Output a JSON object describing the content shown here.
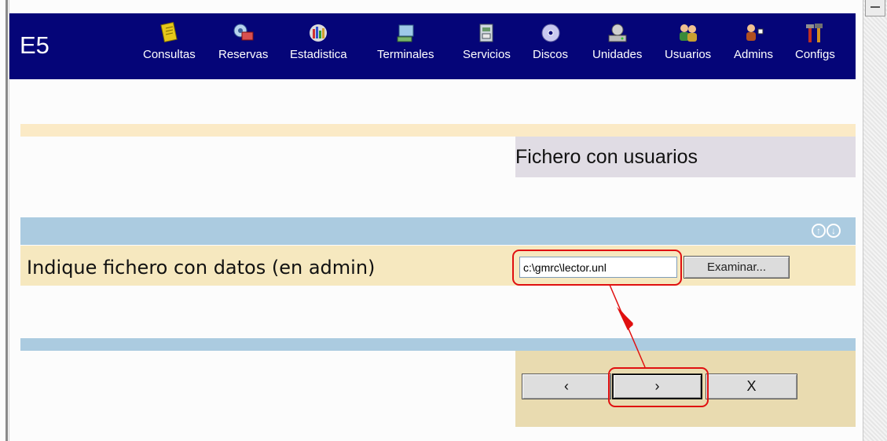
{
  "app": {
    "brand": "E5"
  },
  "nav": [
    {
      "label": "Consultas",
      "icon": "notepad-icon"
    },
    {
      "label": "Reservas",
      "icon": "reservation-icon"
    },
    {
      "label": "Estadistica",
      "icon": "statistics-icon"
    },
    {
      "label": "Terminales",
      "icon": "terminal-icon"
    },
    {
      "label": "Servicios",
      "icon": "services-icon"
    },
    {
      "label": "Discos",
      "icon": "disc-icon"
    },
    {
      "label": "Unidades",
      "icon": "drive-icon"
    },
    {
      "label": "Usuarios",
      "icon": "users-icon"
    },
    {
      "label": "Admins",
      "icon": "admin-icon"
    },
    {
      "label": "Configs",
      "icon": "tools-icon"
    }
  ],
  "page": {
    "title": "Fichero con usuarios"
  },
  "form": {
    "label": "Indique fichero con datos (en admin)",
    "file_value": "c:\\gmrc\\lector.unl",
    "browse_label": "Examinar...",
    "move_up_icon": "arrow-up-circle-icon",
    "move_down_icon": "arrow-down-circle-icon"
  },
  "wizard": {
    "back_label": "‹",
    "next_label": "›",
    "cancel_label": "X"
  },
  "colors": {
    "topbar": "#050578",
    "cream": "#f6e8bf",
    "blue_band": "#abcbe0",
    "title_box": "#e0dce4",
    "nav_box": "#e9dbb0",
    "highlight": "#e01010"
  }
}
